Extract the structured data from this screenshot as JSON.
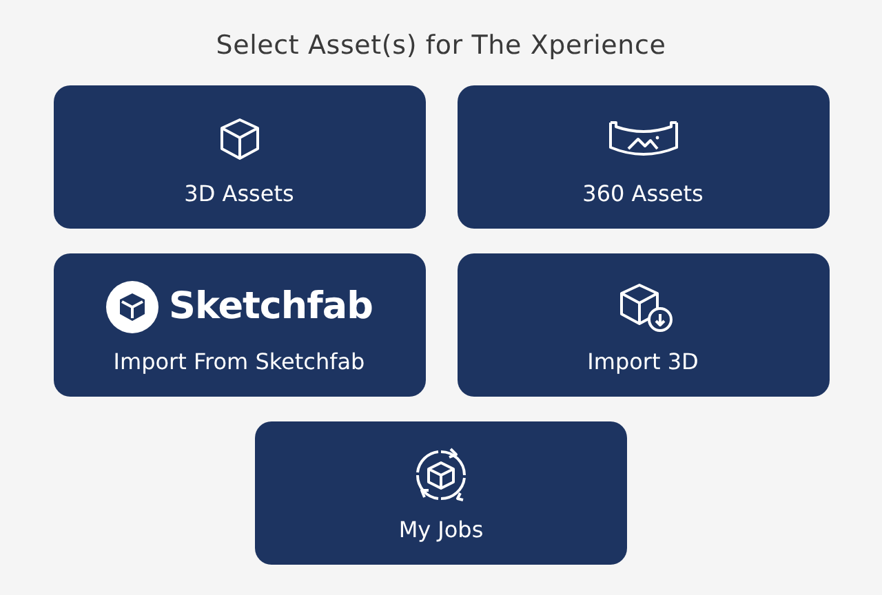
{
  "title": "Select Asset(s) for The Xperience",
  "options": [
    {
      "kind": "cube",
      "label": "3D Assets"
    },
    {
      "kind": "panorama",
      "label": "360 Assets"
    },
    {
      "kind": "logo",
      "logo_text": "Sketchfab",
      "label": "Import From Sketchfab"
    },
    {
      "kind": "import",
      "label": "Import 3D"
    },
    {
      "kind": "jobs",
      "label": "My Jobs"
    }
  ]
}
